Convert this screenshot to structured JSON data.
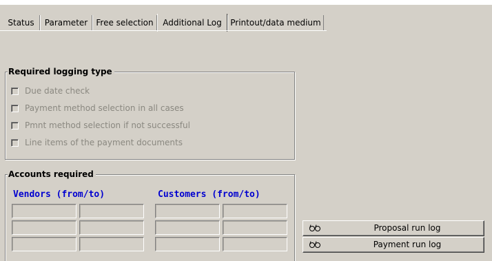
{
  "tabs": [
    {
      "label": "Status",
      "active": false
    },
    {
      "label": "Parameter",
      "active": false
    },
    {
      "label": "Free selection",
      "active": false
    },
    {
      "label": "Additional Log",
      "active": true
    },
    {
      "label": "Printout/data medium",
      "active": false
    }
  ],
  "logging": {
    "title": "Required logging type",
    "options": [
      {
        "label": "Due date check",
        "checked": false,
        "enabled": false
      },
      {
        "label": "Payment method selection in all cases",
        "checked": false,
        "enabled": false
      },
      {
        "label": "Pmnt method selection if not successful",
        "checked": false,
        "enabled": false
      },
      {
        "label": "Line items of the payment documents",
        "checked": false,
        "enabled": false
      }
    ]
  },
  "accounts": {
    "title": "Accounts required",
    "vendors_header": "Vendors (from/to)",
    "customers_header": "Customers (from/to)",
    "vendors": [
      [
        "",
        ""
      ],
      [
        "",
        ""
      ],
      [
        "",
        ""
      ]
    ],
    "customers": [
      [
        "",
        ""
      ],
      [
        "",
        ""
      ],
      [
        "",
        ""
      ]
    ]
  },
  "buttons": {
    "proposal_run_log": "Proposal run log",
    "payment_run_log": "Payment run log",
    "icon": "glasses-icon"
  },
  "colors": {
    "background": "#d4d0c8",
    "disabled_text": "#8a8880",
    "header_blue": "#0000d0"
  }
}
